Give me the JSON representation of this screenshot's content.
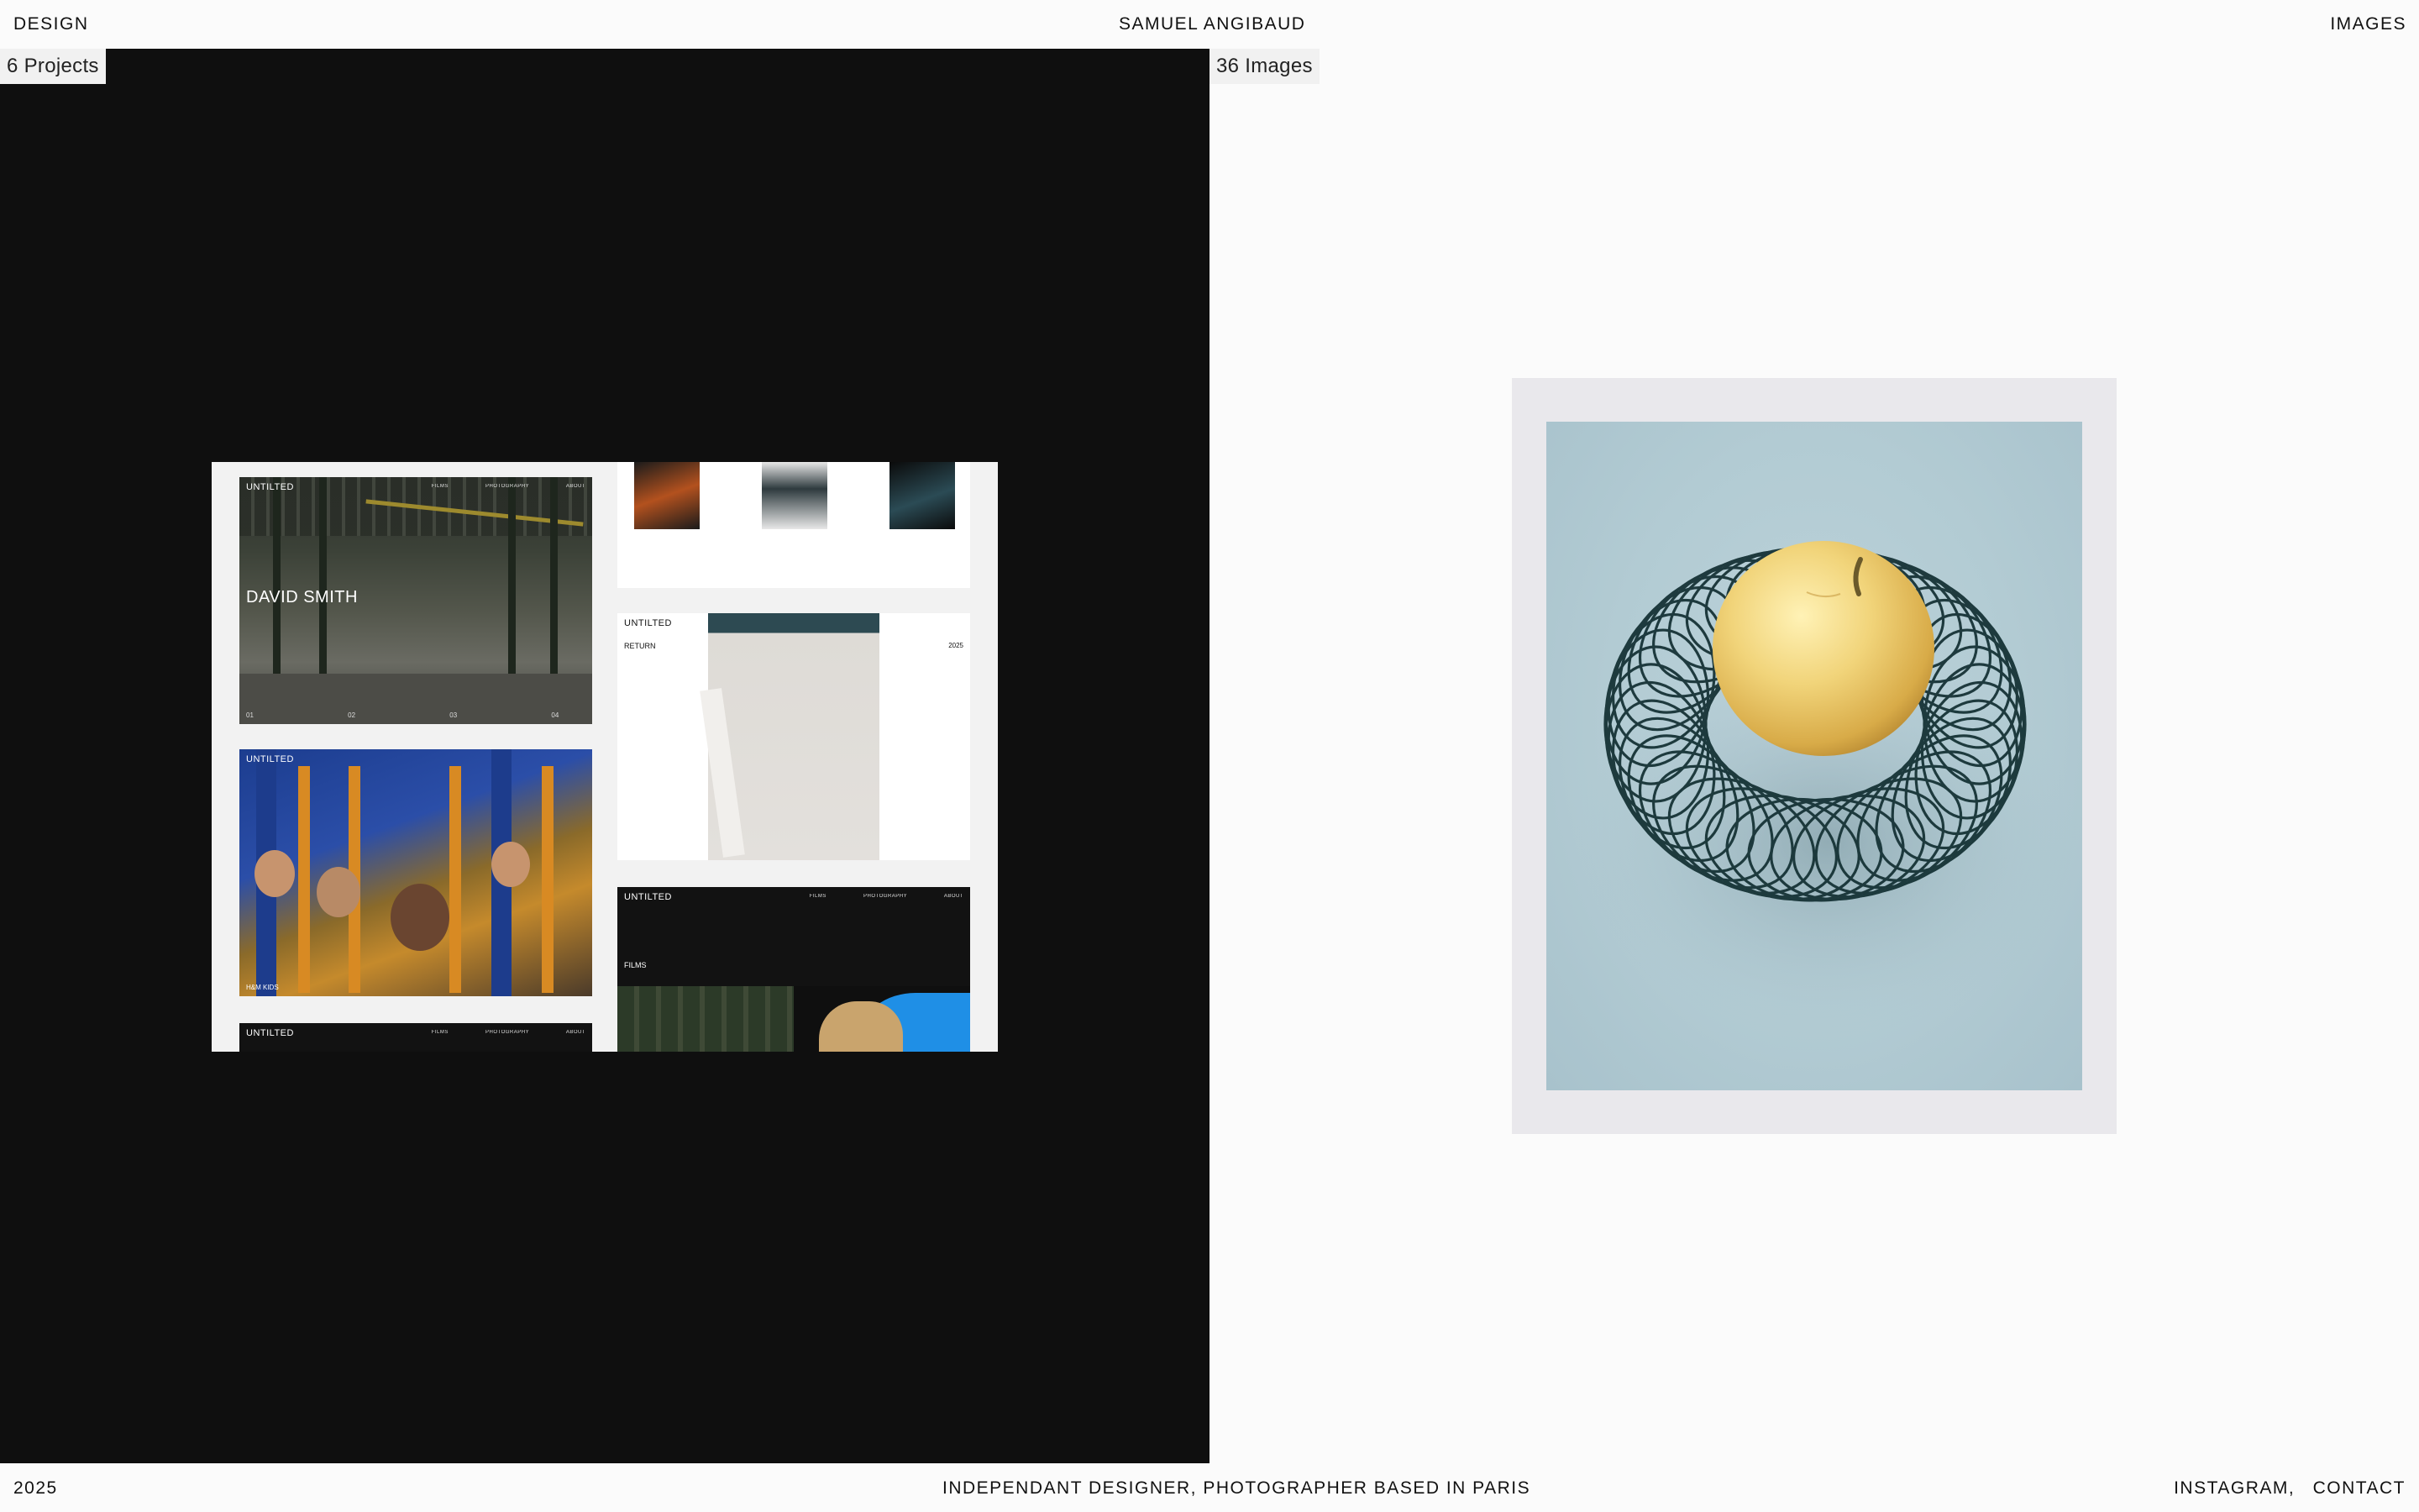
{
  "header": {
    "left_link": "DESIGN",
    "site_name": "SAMUEL ANGIBAUD",
    "right_link": "IMAGES"
  },
  "design_panel": {
    "count": "6 Projects",
    "preview": {
      "card_brand": "UNTILTED",
      "nav_links": "FILMS PHOTOGRAPHY ABOUT",
      "hero_title": "DAVID SMITH",
      "hero_numbers": "01 02 03 04",
      "kids_caption": "H&M KIDS",
      "return_title": "RETURN",
      "return_year": "2025",
      "films_title": "FILMS"
    }
  },
  "images_panel": {
    "count": "36 Images",
    "image_alt_icon": "apple-on-slinky-photo"
  },
  "footer": {
    "year": "2025",
    "tagline": "INDEPENDANT DESIGNER, PHOTOGRAPHER BASED IN PARIS",
    "instagram": "INSTAGRAM,",
    "contact": "CONTACT"
  },
  "colors": {
    "left_panel_bg": "#0f0f0f",
    "right_panel_bg": "#fbfbfb",
    "frame_bg": "#e9e8ec",
    "photo_bg": "#b2cbd3"
  }
}
